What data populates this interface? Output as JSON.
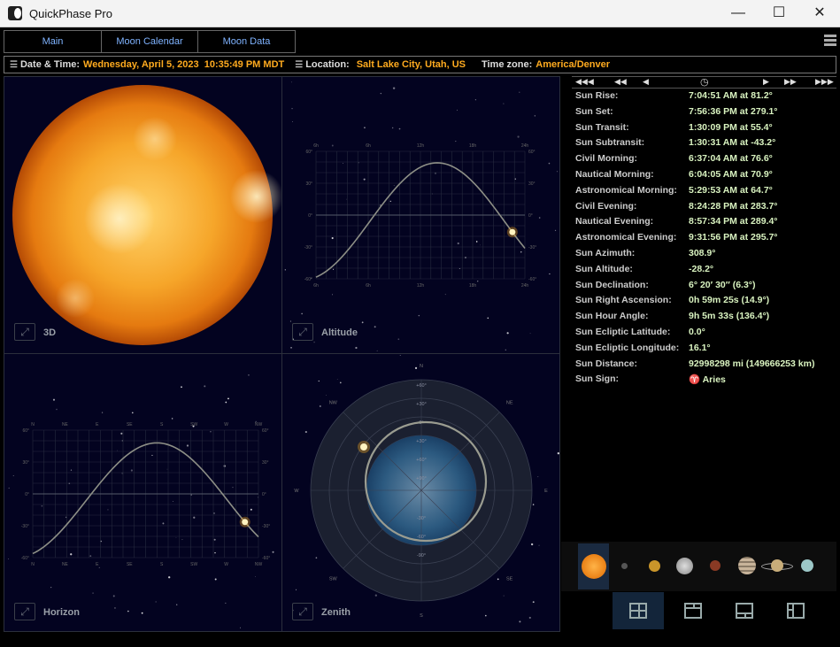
{
  "window": {
    "title": "QuickPhase Pro",
    "minimize": "—",
    "maximize": "☐",
    "close": "✕"
  },
  "tabs": [
    {
      "label": "Main"
    },
    {
      "label": "Moon Calendar"
    },
    {
      "label": "Moon Data"
    }
  ],
  "infobar": {
    "datetime_label": "Date & Time:",
    "datetime_value": "Wednesday, April 5, 2023  10:35:49 PM MDT",
    "location_label": "Location:",
    "location_value": "Salt Lake City, Utah, US",
    "timezone_label": "Time zone:",
    "timezone_value": "America/Denver"
  },
  "panels": {
    "p3d": "3D",
    "altitude": "Altitude",
    "horizon": "Horizon",
    "zenith": "Zenith"
  },
  "nav": {
    "fast_back": "◀◀◀",
    "back": "◀◀",
    "step_back": "◀",
    "now": "◷",
    "step_fwd": "▶",
    "fwd": "▶▶",
    "fast_fwd": "▶▶▶"
  },
  "altitude_chart": {
    "x_ticks": [
      "6h",
      "6h",
      "12h",
      "18h",
      "24h"
    ],
    "y_ticks_left": [
      "60°",
      "30°",
      "0°",
      "-30°",
      "-60°"
    ],
    "y_ticks_right": [
      "60°",
      "30°",
      "0°",
      "-30°",
      "-60°"
    ]
  },
  "horizon_chart": {
    "x_ticks": [
      "N",
      "NE",
      "E",
      "SE",
      "S",
      "SW",
      "W",
      "NW"
    ],
    "y_ticks_left": [
      "60°",
      "30°",
      "0°",
      "-30°",
      "-60°"
    ],
    "y_ticks_right": [
      "60°",
      "30°",
      "0°",
      "-30°",
      "-60°"
    ]
  },
  "zenith_chart": {
    "compass": [
      "N",
      "NE",
      "E",
      "SE",
      "S",
      "SW",
      "W",
      "NW"
    ],
    "rings": [
      "+60°",
      "+30°",
      "0°",
      "+30°",
      "+60°",
      "-30°",
      "-60°",
      "-90°",
      "+90°"
    ]
  },
  "sun_data": [
    {
      "label": "Sun Rise:",
      "value": "7:04:51 AM at 81.2°"
    },
    {
      "label": "Sun Set:",
      "value": "7:56:36 PM at 279.1°"
    },
    {
      "label": "Sun Transit:",
      "value": "1:30:09 PM at 55.4°"
    },
    {
      "label": "Sun Subtransit:",
      "value": "1:30:31 AM at -43.2°"
    },
    {
      "label": "Civil Morning:",
      "value": "6:37:04 AM at 76.6°"
    },
    {
      "label": "Nautical Morning:",
      "value": "6:04:05 AM at 70.9°"
    },
    {
      "label": "Astronomical Morning:",
      "value": "5:29:53 AM at 64.7°"
    },
    {
      "label": "Civil Evening:",
      "value": "8:24:28 PM at 283.7°"
    },
    {
      "label": "Nautical Evening:",
      "value": "8:57:34 PM at 289.4°"
    },
    {
      "label": "Astronomical Evening:",
      "value": "9:31:56 PM at 295.7°"
    },
    {
      "label": "Sun Azimuth:",
      "value": "308.9°"
    },
    {
      "label": "Sun Altitude:",
      "value": "-28.2°"
    },
    {
      "label": "Sun Declination:",
      "value": "6° 20′ 30″ (6.3°)"
    },
    {
      "label": "Sun Right Ascension:",
      "value": "0h 59m 25s (14.9°)"
    },
    {
      "label": "Sun Hour Angle:",
      "value": "9h 5m 33s (136.4°)"
    },
    {
      "label": "Sun Ecliptic Latitude:",
      "value": "0.0°"
    },
    {
      "label": "Sun Ecliptic Longitude:",
      "value": "16.1°"
    },
    {
      "label": "Sun Distance:",
      "value": "92998298 mi (149666253 km)"
    },
    {
      "label": "Sun Sign:",
      "value": "♈ Aries"
    }
  ],
  "bodies": [
    "sun",
    "mercury",
    "venus",
    "moon",
    "mars",
    "jupiter",
    "saturn",
    "uranus"
  ],
  "colors": {
    "accent": "#ffab1f",
    "tab_text": "#7fb3ff",
    "value_text": "#d9f3c0",
    "panel_bg": "#030320"
  }
}
